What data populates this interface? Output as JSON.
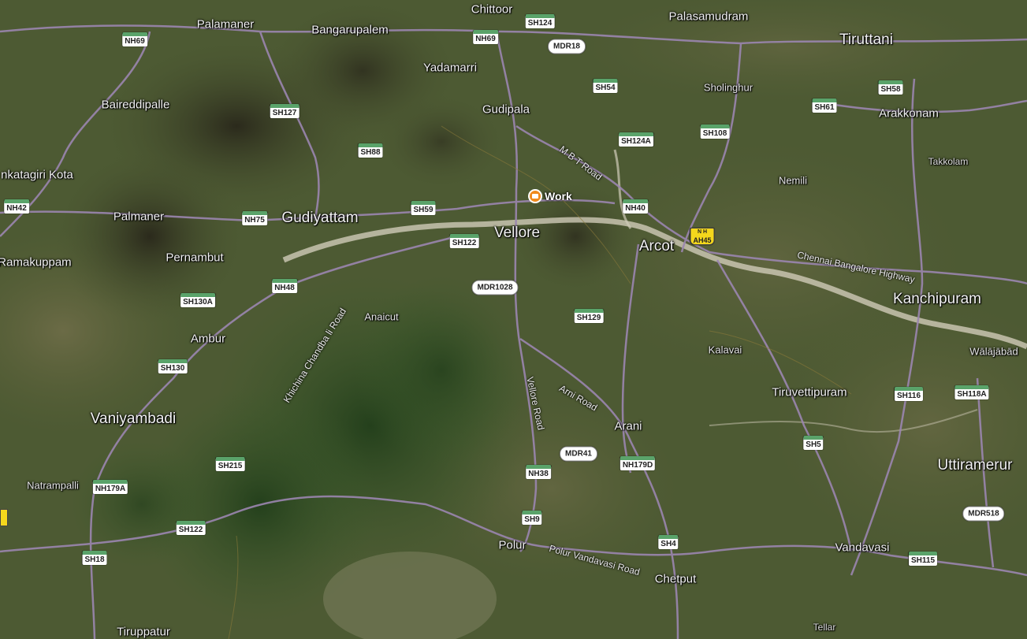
{
  "map": {
    "colors": {
      "terrain": "#4a5530",
      "forest": "#2f4a24",
      "hills": "#3a3a28",
      "river": "#cfcbb8",
      "road": "#9b86b0",
      "shield_green": "#5aa36a",
      "ah_yellow": "#f4d71c",
      "poi_orange": "#f08a1c"
    },
    "places": [
      {
        "id": "chittoor",
        "name": "Chittoor",
        "size": "mid"
      },
      {
        "id": "palasamudram",
        "name": "Palasamudram",
        "size": "mid"
      },
      {
        "id": "palamaner",
        "name": "Palamaner",
        "size": "mid"
      },
      {
        "id": "bangarupalem",
        "name": "Bangarupalem",
        "size": "mid"
      },
      {
        "id": "tiruttani",
        "name": "Tiruttani",
        "size": "big"
      },
      {
        "id": "yadamarri",
        "name": "Yadamarri",
        "size": "mid"
      },
      {
        "id": "sholinghur",
        "name": "Sholinghur",
        "size": "sm"
      },
      {
        "id": "baireddipalle",
        "name": "Baireddipalle",
        "size": "mid"
      },
      {
        "id": "gudipala",
        "name": "Gudipala",
        "size": "mid"
      },
      {
        "id": "arakkonam",
        "name": "Arakkonam",
        "size": "mid"
      },
      {
        "id": "takkolam",
        "name": "Takkolam",
        "size": "xs"
      },
      {
        "id": "venkatagiri",
        "name": "nkatagiri Kota",
        "size": "mid"
      },
      {
        "id": "nemili",
        "name": "Nemili",
        "size": "sm"
      },
      {
        "id": "palmaner",
        "name": "Palmaner",
        "size": "mid"
      },
      {
        "id": "gudiyattam",
        "name": "Gudiyattam",
        "size": "big"
      },
      {
        "id": "vellore",
        "name": "Vellore",
        "size": "big"
      },
      {
        "id": "arcot",
        "name": "Arcot",
        "size": "big"
      },
      {
        "id": "ramakuppam",
        "name": "Ramakuppam",
        "size": "mid"
      },
      {
        "id": "pernambut",
        "name": "Pernambut",
        "size": "mid"
      },
      {
        "id": "kanchipuram",
        "name": "Kanchipuram",
        "size": "big"
      },
      {
        "id": "anaicut",
        "name": "Anaicut",
        "size": "sm"
      },
      {
        "id": "ambur",
        "name": "Ambur",
        "size": "mid"
      },
      {
        "id": "kalavai",
        "name": "Kalavai",
        "size": "sm"
      },
      {
        "id": "walajabad",
        "name": "Wālājābād",
        "size": "sm"
      },
      {
        "id": "tiruvettipuram",
        "name": "Tiruvettipuram",
        "size": "mid"
      },
      {
        "id": "vaniyambadi",
        "name": "Vaniyambadi",
        "size": "big"
      },
      {
        "id": "arani",
        "name": "Arani",
        "size": "mid"
      },
      {
        "id": "uttiramerur",
        "name": "Uttiramerur",
        "size": "big"
      },
      {
        "id": "natrampalli",
        "name": "Natrampalli",
        "size": "sm"
      },
      {
        "id": "polur",
        "name": "Polur",
        "size": "mid"
      },
      {
        "id": "vandavasi",
        "name": "Vandavasi",
        "size": "mid"
      },
      {
        "id": "chetput",
        "name": "Chetput",
        "size": "mid"
      },
      {
        "id": "tiruppatur",
        "name": "Tiruppatur",
        "size": "mid"
      },
      {
        "id": "tellar",
        "name": "Tellar",
        "size": "xs"
      }
    ],
    "shields": [
      {
        "id": "nh69a",
        "text": "NH69",
        "type": "nh"
      },
      {
        "id": "nh69b",
        "text": "NH69",
        "type": "nh"
      },
      {
        "id": "sh124",
        "text": "SH124",
        "type": "sh"
      },
      {
        "id": "mdr18",
        "text": "MDR18",
        "type": "mdr"
      },
      {
        "id": "sh54",
        "text": "SH54",
        "type": "sh"
      },
      {
        "id": "sh58",
        "text": "SH58",
        "type": "sh"
      },
      {
        "id": "sh127",
        "text": "SH127",
        "type": "sh"
      },
      {
        "id": "sh61",
        "text": "SH61",
        "type": "sh"
      },
      {
        "id": "sh124a",
        "text": "SH124A",
        "type": "sh"
      },
      {
        "id": "sh108",
        "text": "SH108",
        "type": "sh"
      },
      {
        "id": "sh88",
        "text": "SH88",
        "type": "sh"
      },
      {
        "id": "nh42",
        "text": "NH42",
        "type": "nh"
      },
      {
        "id": "sh59",
        "text": "SH59",
        "type": "sh"
      },
      {
        "id": "nh40",
        "text": "NH40",
        "type": "nh"
      },
      {
        "id": "nh75",
        "text": "NH75",
        "type": "nh"
      },
      {
        "id": "sh122a",
        "text": "SH122",
        "type": "sh"
      },
      {
        "id": "mdr1028",
        "text": "MDR1028",
        "type": "mdr"
      },
      {
        "id": "nh48",
        "text": "NH48",
        "type": "nh"
      },
      {
        "id": "sh130a",
        "text": "SH130A",
        "type": "sh"
      },
      {
        "id": "sh129",
        "text": "SH129",
        "type": "sh"
      },
      {
        "id": "sh130",
        "text": "SH130",
        "type": "sh"
      },
      {
        "id": "sh116",
        "text": "SH116",
        "type": "sh"
      },
      {
        "id": "sh118a",
        "text": "SH118A",
        "type": "sh"
      },
      {
        "id": "sh5",
        "text": "SH5",
        "type": "sh"
      },
      {
        "id": "mdr41",
        "text": "MDR41",
        "type": "mdr"
      },
      {
        "id": "sh215",
        "text": "SH215",
        "type": "sh"
      },
      {
        "id": "nh179d",
        "text": "NH179D",
        "type": "nh"
      },
      {
        "id": "nh38",
        "text": "NH38",
        "type": "nh"
      },
      {
        "id": "nh179a",
        "text": "NH179A",
        "type": "nh"
      },
      {
        "id": "mdr518",
        "text": "MDR518",
        "type": "mdr"
      },
      {
        "id": "sh9",
        "text": "SH9",
        "type": "sh"
      },
      {
        "id": "sh122b",
        "text": "SH122",
        "type": "sh"
      },
      {
        "id": "sh4",
        "text": "SH4",
        "type": "sh"
      },
      {
        "id": "sh18",
        "text": "SH18",
        "type": "sh"
      },
      {
        "id": "sh115",
        "text": "SH115",
        "type": "sh"
      }
    ],
    "asian_highway": {
      "top": "N H",
      "text": "AH45"
    },
    "road_names": [
      {
        "id": "mbt",
        "text": "M B T Road"
      },
      {
        "id": "chennai",
        "text": "Chennai Bangalore Highway"
      },
      {
        "id": "khichina",
        "text": "Khichina Chandba li Road"
      },
      {
        "id": "vellore_rd",
        "text": "Vellore Road"
      },
      {
        "id": "arni_rd",
        "text": "Arni Road"
      },
      {
        "id": "polur_rd",
        "text": "Polur Vandavasi Road"
      }
    ],
    "poi": {
      "label": "Work",
      "icon": "briefcase-icon"
    }
  }
}
